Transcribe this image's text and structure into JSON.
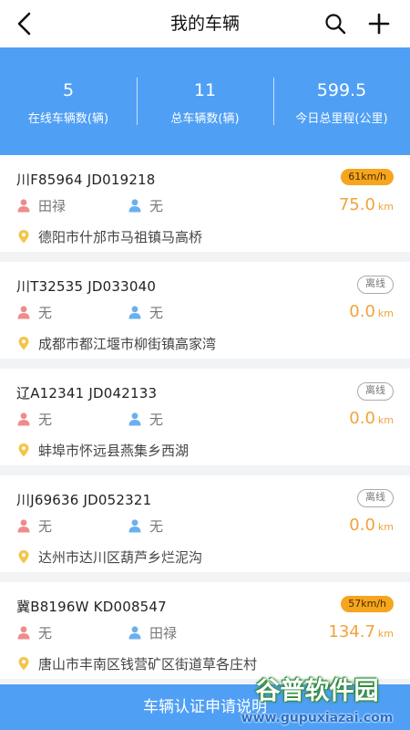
{
  "header": {
    "title": "我的车辆",
    "back_icon": "back-arrow-icon",
    "search_icon": "search-icon",
    "add_icon": "plus-icon"
  },
  "stats": [
    {
      "value": "5",
      "label": "在线车辆数(辆)"
    },
    {
      "value": "11",
      "label": "总车辆数(辆)"
    },
    {
      "value": "599.5",
      "label": "今日总里程(公里)"
    }
  ],
  "vehicles": [
    {
      "plate": "川F85964  JD019218",
      "badge": "61km/h",
      "badge_type": "speed",
      "driver": "田禄",
      "codriver": "无",
      "mileage": "75.0",
      "unit": "km",
      "location": "德阳市什邡市马祖镇马高桥"
    },
    {
      "plate": "川T32535  JD033040",
      "badge": "离线",
      "badge_type": "offline",
      "driver": "无",
      "codriver": "无",
      "mileage": "0.0",
      "unit": "km",
      "location": "成都市都江堰市柳街镇高家湾"
    },
    {
      "plate": "辽A12341  JD042133",
      "badge": "离线",
      "badge_type": "offline",
      "driver": "无",
      "codriver": "无",
      "mileage": "0.0",
      "unit": "km",
      "location": "蚌埠市怀远县燕集乡西湖"
    },
    {
      "plate": "川J69636  JD052321",
      "badge": "离线",
      "badge_type": "offline",
      "driver": "无",
      "codriver": "无",
      "mileage": "0.0",
      "unit": "km",
      "location": "达州市达川区葫芦乡烂泥沟"
    },
    {
      "plate": "冀B8196W  KD008547",
      "badge": "57km/h",
      "badge_type": "speed",
      "driver": "无",
      "codriver": "田禄",
      "mileage": "134.7",
      "unit": "km",
      "location": "唐山市丰南区钱营矿区街道草各庄村"
    }
  ],
  "footer": {
    "label": "车辆认证申请说明"
  },
  "watermark": {
    "main": "谷普软件园",
    "sub": "www.gupuxiazai.com"
  },
  "colors": {
    "accent": "#4f9ff5",
    "speed_badge": "#f6a51e",
    "mileage": "#f2a23a",
    "driver_icon": "#f08b8b",
    "codriver_icon": "#6ab0ee",
    "location_icon": "#f3c64a"
  }
}
